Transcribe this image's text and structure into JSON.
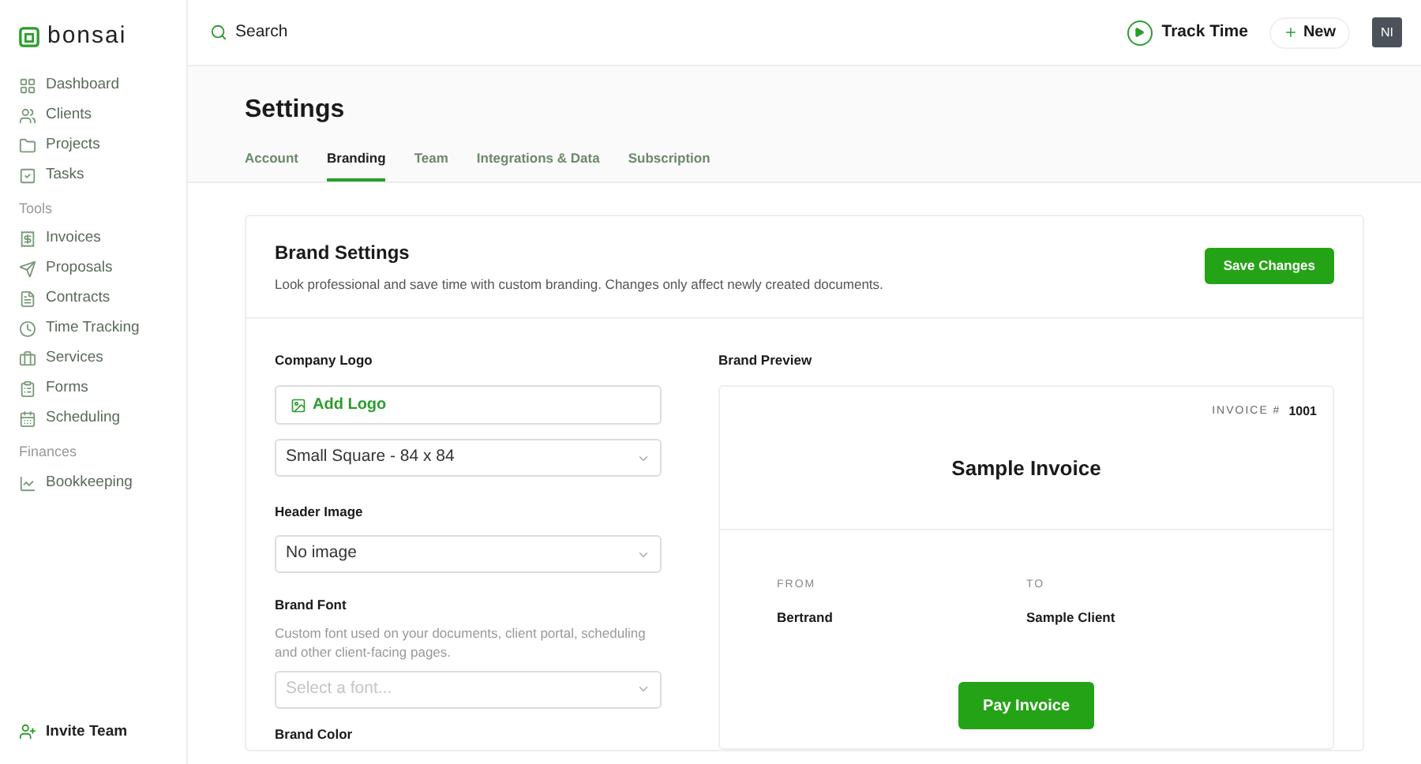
{
  "brand": {
    "name": "bonsai"
  },
  "sidebar": {
    "groups": [
      {
        "items": [
          {
            "label": "Dashboard"
          },
          {
            "label": "Clients"
          },
          {
            "label": "Projects"
          },
          {
            "label": "Tasks"
          }
        ]
      },
      {
        "title": "Tools",
        "items": [
          {
            "label": "Invoices"
          },
          {
            "label": "Proposals"
          },
          {
            "label": "Contracts"
          },
          {
            "label": "Time Tracking"
          },
          {
            "label": "Services"
          },
          {
            "label": "Forms"
          },
          {
            "label": "Scheduling"
          }
        ]
      },
      {
        "title": "Finances",
        "items": [
          {
            "label": "Bookkeeping"
          }
        ]
      }
    ],
    "footer": {
      "label": "Invite Team"
    }
  },
  "topbar": {
    "search": {
      "placeholder": "Search"
    },
    "track_time": "Track Time",
    "new_button": "New",
    "avatar": "NI"
  },
  "page": {
    "title": "Settings",
    "tabs": [
      {
        "label": "Account",
        "selected": false
      },
      {
        "label": "Branding",
        "selected": true
      },
      {
        "label": "Team",
        "selected": false
      },
      {
        "label": "Integrations & Data",
        "selected": false
      },
      {
        "label": "Subscription",
        "selected": false
      }
    ]
  },
  "card": {
    "title": "Brand Settings",
    "description": "Look professional and save time with custom branding. Changes only affect newly created documents.",
    "save_button": "Save Changes",
    "company_logo": {
      "label": "Company Logo",
      "add_button": "Add Logo",
      "size_select": "Small Square - 84 x 84"
    },
    "header_image": {
      "label": "Header Image",
      "select": "No image"
    },
    "brand_font": {
      "label": "Brand Font",
      "hint": "Custom font used on your documents, client portal, scheduling and other client-facing pages.",
      "placeholder": "Select a font..."
    },
    "brand_color": {
      "label": "Brand Color"
    },
    "preview": {
      "label": "Brand Preview",
      "invoice_label": "INVOICE #",
      "invoice_number": "1001",
      "title": "Sample Invoice",
      "from_label": "FROM",
      "from_value": "Bertrand",
      "to_label": "TO",
      "to_value": "Sample Client",
      "pay_button": "Pay Invoice"
    }
  }
}
